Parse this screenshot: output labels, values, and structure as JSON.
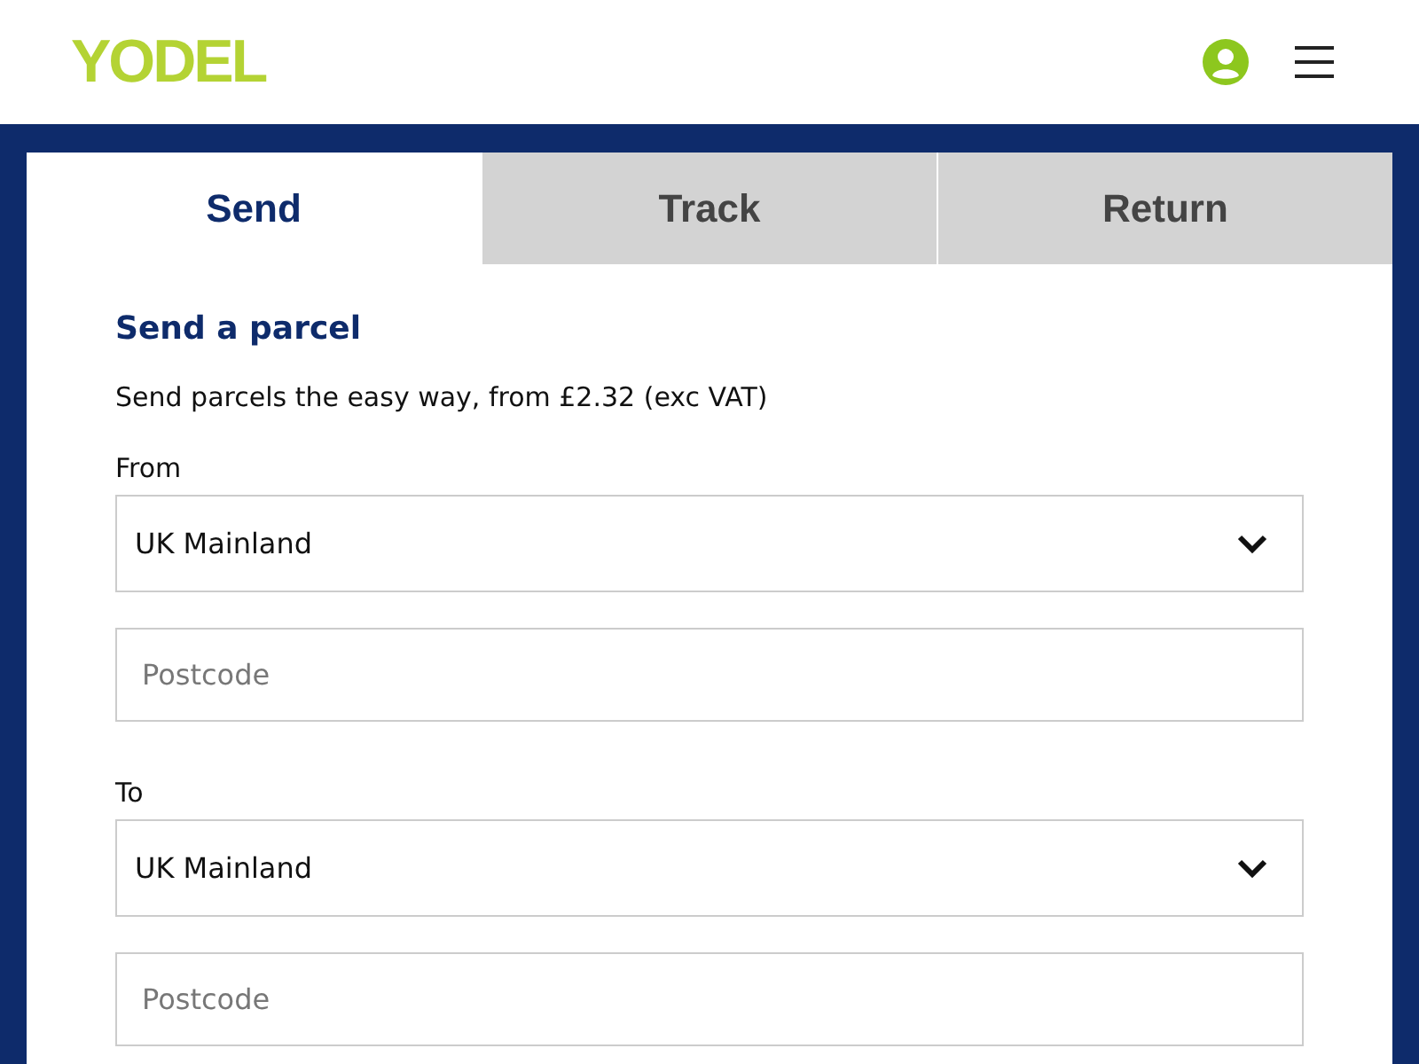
{
  "header": {
    "logo": "YODEL"
  },
  "tabs": [
    {
      "label": "Send",
      "selected": true
    },
    {
      "label": "Track",
      "selected": false
    },
    {
      "label": "Return",
      "selected": false
    }
  ],
  "form": {
    "title": "Send a parcel",
    "intro": "Send parcels the easy way, from £2.32 (exc VAT)",
    "groups": [
      {
        "label": "From",
        "select": "UK Mainland",
        "postcode": {
          "placeholder": "Postcode"
        }
      },
      {
        "label": "To",
        "select": "UK Mainland",
        "postcode": {
          "placeholder": "Postcode"
        }
      }
    ]
  }
}
